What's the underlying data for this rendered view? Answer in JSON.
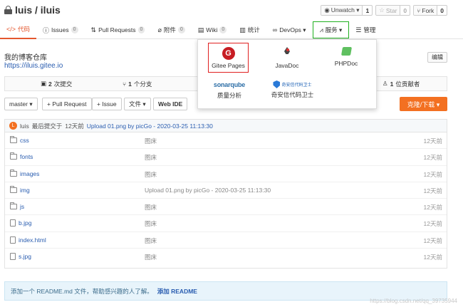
{
  "repo": {
    "title": "luis / iluis"
  },
  "controls": {
    "unwatch": {
      "label": "Unwatch ▾",
      "count": "1"
    },
    "star": {
      "label": "Star",
      "count": "0"
    },
    "fork": {
      "label": "Fork",
      "count": "0"
    }
  },
  "tabs": [
    {
      "icon": "</>",
      "label": "代码"
    },
    {
      "icon": "ⓘ",
      "label": "Issues",
      "badge": "0"
    },
    {
      "icon": "⇅",
      "label": "Pull Requests",
      "badge": "0"
    },
    {
      "icon": "⌀",
      "label": "附件",
      "badge": "0"
    },
    {
      "icon": "▤",
      "label": "Wiki",
      "badge": "0"
    },
    {
      "icon": "▥",
      "label": "统计"
    },
    {
      "icon": "∞",
      "label": "DevOps ▾"
    },
    {
      "icon": "⩘",
      "label": "服务 ▾"
    },
    {
      "icon": "☰",
      "label": "管理"
    }
  ],
  "description": "我的博客仓库",
  "homepage": "https://iluis.gitee.io",
  "edit_label": "编辑",
  "stats": {
    "commits": {
      "num": "2",
      "label": "次提交"
    },
    "branches": {
      "num": "1",
      "label": "个分支"
    },
    "contributors": {
      "num": "1",
      "label": "位贡献者"
    }
  },
  "toolbar": {
    "branch": "master ▾",
    "pull_request": "+ Pull Request",
    "issue": "+ Issue",
    "file": "文件 ▾",
    "webide": "Web IDE",
    "clone": "克隆/下载 ▾"
  },
  "commit": {
    "avatar": "L",
    "author": "luis",
    "text": "最后提交于",
    "when": "12天前",
    "message": "Upload 01.png by picGo - 2020-03-25 11:13:30"
  },
  "files": [
    {
      "name": "css",
      "type": "folder",
      "msg": "图床",
      "time": "12天前"
    },
    {
      "name": "fonts",
      "type": "folder",
      "msg": "图床",
      "time": "12天前"
    },
    {
      "name": "images",
      "type": "folder",
      "msg": "图床",
      "time": "12天前"
    },
    {
      "name": "img",
      "type": "folder",
      "msg": "Upload 01.png by picGo - 2020-03-25 11:13:30",
      "time": "12天前"
    },
    {
      "name": "js",
      "type": "folder",
      "msg": "图床",
      "time": "12天前"
    },
    {
      "name": "b.jpg",
      "type": "file",
      "msg": "图床",
      "time": "12天前"
    },
    {
      "name": "index.html",
      "type": "file",
      "msg": "图床",
      "time": "12天前"
    },
    {
      "name": "s.jpg",
      "type": "file",
      "msg": "图床",
      "time": "12天前"
    }
  ],
  "readme": {
    "text": "添加一个 README.md 文件，帮助感兴趣的人了解。",
    "action": "添加 README"
  },
  "watermark": "https://blog.csdn.net/qq_39735944",
  "services_menu": {
    "gitee_logo": "G",
    "gitee_pages": "Gitee Pages",
    "javadoc": "JavaDoc",
    "phpdoc": "PHPDoc",
    "sonar_logo": "sonarqube",
    "sonar_label": "质量分析",
    "qax_logo": "奇安信代码卫士",
    "qax_label": "奇安信代码卫士"
  }
}
